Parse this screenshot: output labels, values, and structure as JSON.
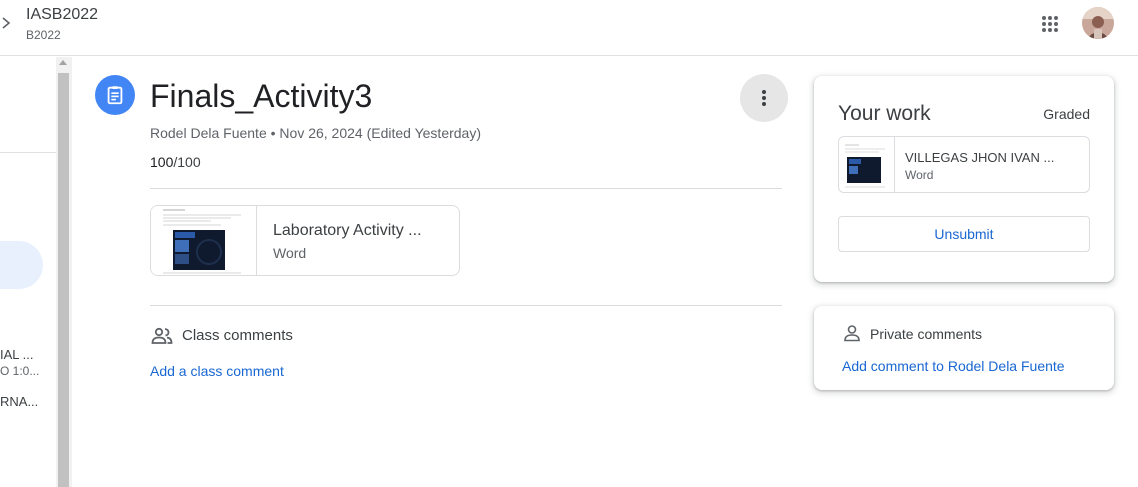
{
  "header": {
    "class_name": "IASB2022",
    "section": "B2022"
  },
  "sidebar": {
    "item_1_title": "IAL ...",
    "item_1_sub": "O 1:0...",
    "item_2_title": "RNA..."
  },
  "assignment": {
    "title": "Finals_Activity3",
    "meta": "Rodel Dela Fuente • Nov 26, 2024 (Edited Yesterday)",
    "points_earned": "100",
    "points_total": "/100",
    "attachment": {
      "name": "Laboratory Activity ...",
      "type": "Word"
    },
    "class_comments_label": "Class comments",
    "add_class_comment": "Add a class comment"
  },
  "your_work": {
    "title": "Your work",
    "status": "Graded",
    "file": {
      "name": "VILLEGAS JHON IVAN ...",
      "type": "Word"
    },
    "unsubmit_label": "Unsubmit"
  },
  "private_comments": {
    "label": "Private comments",
    "add_label": "Add comment to Rodel Dela Fuente"
  },
  "colors": {
    "accent": "#4285f4",
    "link": "#1967d2",
    "selected_bg": "#e8f0fe"
  },
  "icons": {
    "back": "chevron-right-icon",
    "apps": "google-apps-icon",
    "assignment": "assignment-icon",
    "more": "more-vert-icon",
    "class_comments": "people-icon",
    "private_comments": "person-icon"
  }
}
